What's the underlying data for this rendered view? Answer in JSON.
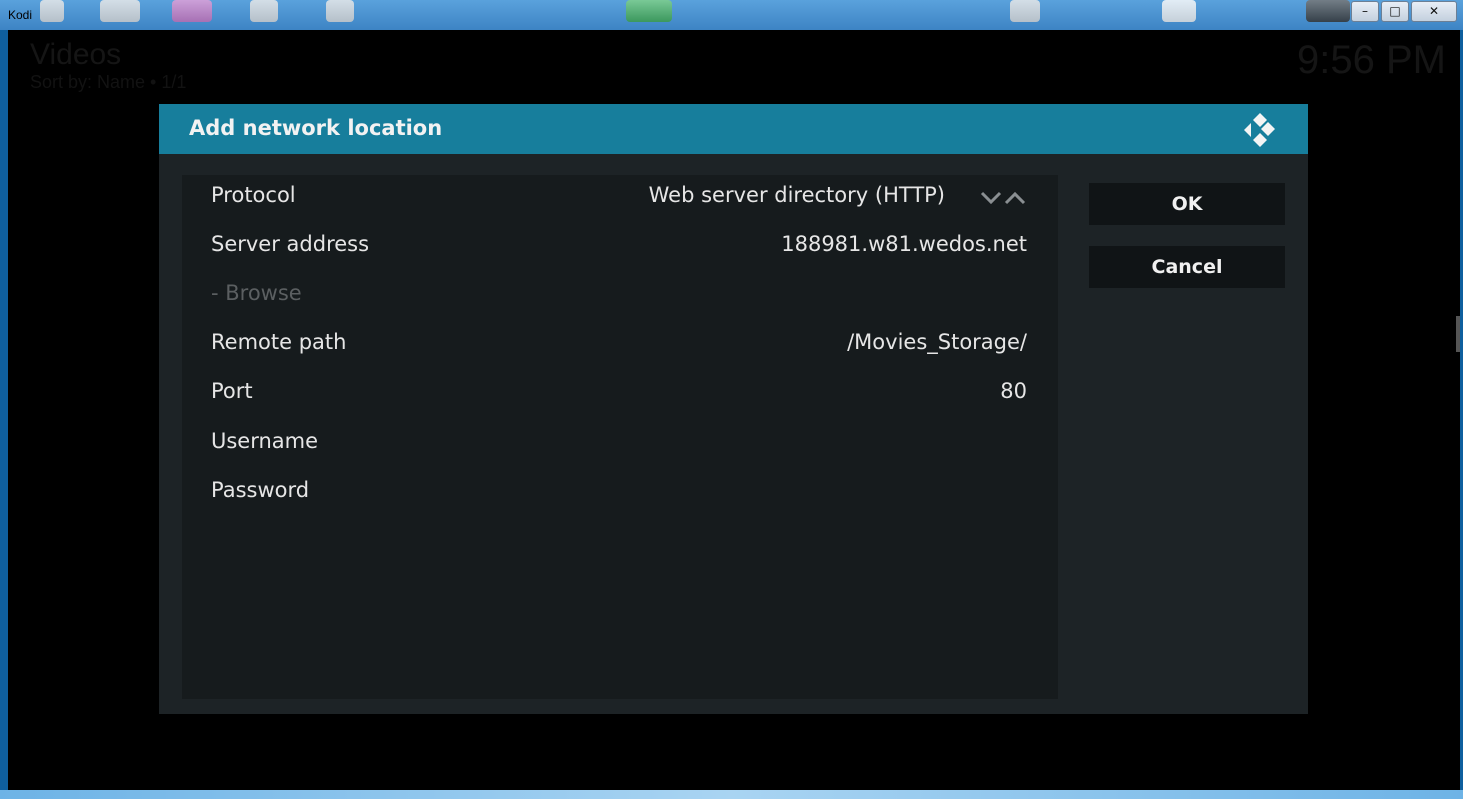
{
  "window": {
    "title": "Kodi",
    "controls": {
      "minimize": "–",
      "maximize": "□",
      "close": "✕"
    }
  },
  "background": {
    "title": "Videos",
    "subtitle": "Sort by: Name • 1/1",
    "clock": "9:56 PM"
  },
  "dialog": {
    "title": "Add network location",
    "logo_icon": "kodi-logo-icon",
    "fields": [
      {
        "label": "Protocol",
        "value": "Web server directory (HTTP)",
        "disabled": false
      },
      {
        "label": "Server address",
        "value": "188981.w81.wedos.net",
        "disabled": false
      },
      {
        "label": "- Browse",
        "value": "",
        "disabled": true
      },
      {
        "label": "Remote path",
        "value": "/Movies_Storage/",
        "disabled": false
      },
      {
        "label": "Port",
        "value": "80",
        "disabled": false
      },
      {
        "label": "Username",
        "value": "",
        "disabled": false
      },
      {
        "label": "Password",
        "value": "",
        "disabled": false
      }
    ],
    "buttons": {
      "ok": "OK",
      "cancel": "Cancel"
    }
  },
  "colors": {
    "header": "#177e9c",
    "dialog_bg": "#1d2326",
    "panel_bg": "#161b1d",
    "button_bg": "#101416"
  }
}
